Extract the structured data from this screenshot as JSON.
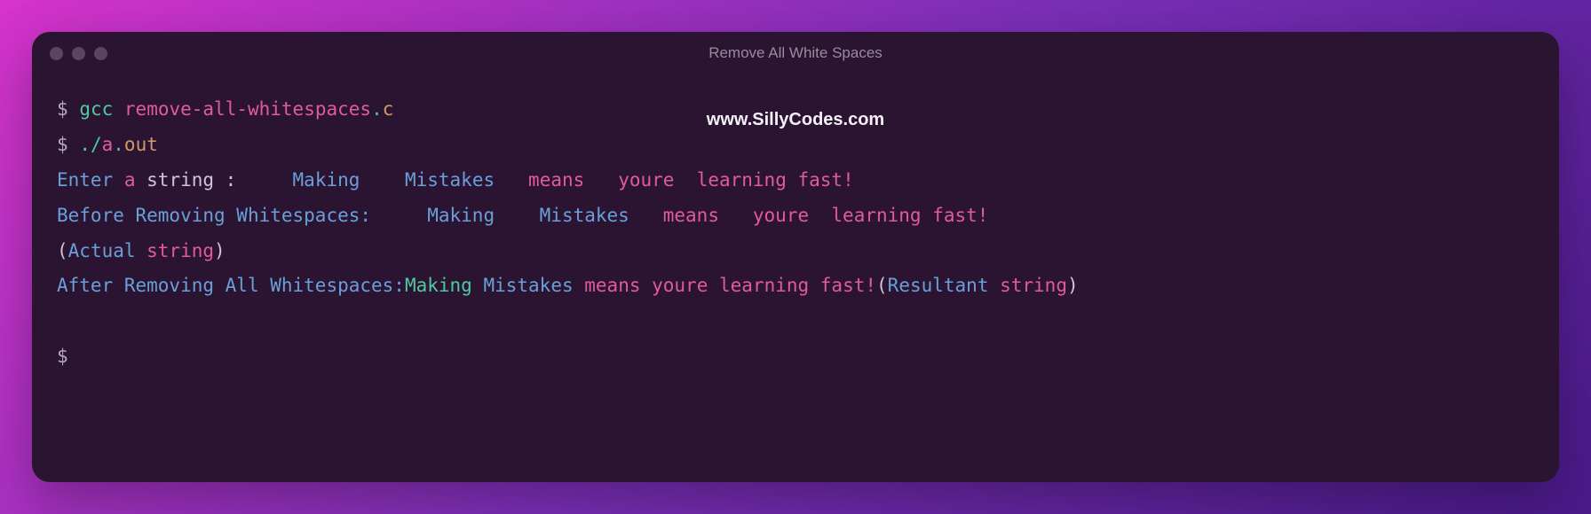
{
  "window": {
    "title": "Remove All White Spaces"
  },
  "watermark": "www.SillyCodes.com",
  "terminal": {
    "prompt": "$",
    "line1": {
      "cmd": "gcc",
      "arg1": "remove-all-whitespaces",
      "dot": ".",
      "ext": "c"
    },
    "line2": {
      "dotslash": "./",
      "a": "a",
      "dot2": ".",
      "out": "out"
    },
    "line3": {
      "part1": "Enter",
      "part2": " a ",
      "part3": "string",
      "part4": " :     ",
      "part5": "Making",
      "part6": "    Mistakes   ",
      "part7": "means",
      "part8": "   youre  ",
      "part9": "learning fast!"
    },
    "line4": {
      "part1": "Before",
      "part2": " Removing ",
      "part3": "Whitespaces:",
      "part4": "     Making",
      "part5": "    Mistakes   ",
      "part6": "means",
      "part7": "   youre  ",
      "part8": "learning fast!"
    },
    "line5": {
      "part1": "(",
      "part2": "Actual",
      "part3": " string",
      "part4": ")"
    },
    "line6": {
      "part1": "After",
      "part2": " Removing ",
      "part3": "All",
      "part4": " Whitespaces:",
      "part5": "Making",
      "part6": " Mistakes ",
      "part7": "means",
      "part8": " youre ",
      "part9": "learning fast!",
      "part10": "(",
      "part11": "Resultant",
      "part12": " string",
      "part13": ")"
    }
  }
}
